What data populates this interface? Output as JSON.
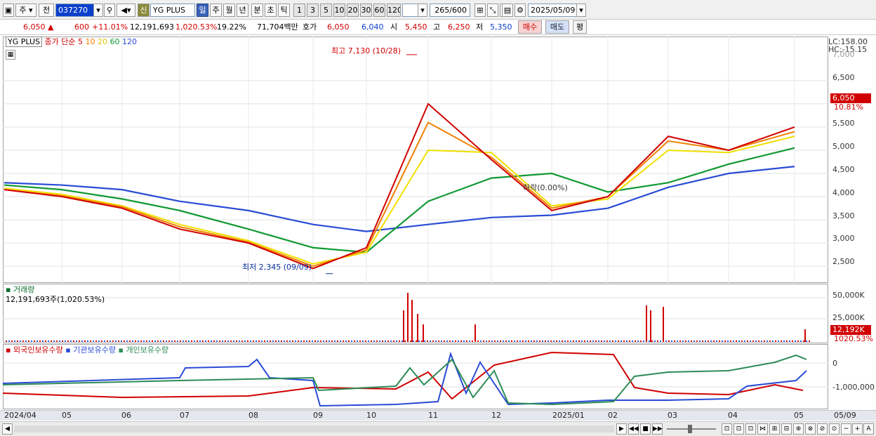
{
  "toolbar": {
    "market": "주",
    "prev": "전",
    "code": "037270",
    "tag_new": "신",
    "stock_name": "YG PLUS",
    "periods": [
      "일",
      "주",
      "월",
      "년",
      "분",
      "초",
      "틱"
    ],
    "intervals": [
      "1",
      "3",
      "5",
      "10",
      "20",
      "30",
      "60",
      "120"
    ],
    "count": "265/600",
    "date": "2025/05/09"
  },
  "quote": {
    "price": "6,050 ▲",
    "change": "600",
    "change_pct": "+11.01%",
    "volume": "12,191,693",
    "volume_pct": "1,020.53%",
    "turnover": "19.22%",
    "amount": "71,704백만",
    "hoga_label": "호가",
    "ask": "6,050",
    "bid": "6,040",
    "open_label": "시",
    "open": "5,450",
    "high_label": "고",
    "high": "6,250",
    "low_label": "저",
    "low": "5,350",
    "buy": "매수",
    "sell": "매도",
    "eval": "평"
  },
  "price_panel": {
    "name": "YG PLUS",
    "legend": {
      "close": "종가",
      "type": "단순",
      "ma5": "5",
      "ma10": "10",
      "ma20": "20",
      "ma60": "60",
      "ma120": "120"
    },
    "high_note": "최고 7,130 (10/28)",
    "low_note": "최저 2,345 (09/09)",
    "mid_note": "하락(0.00%)",
    "lc": "LC:158.00",
    "hc": "HC:-15.15",
    "price_tag": "6,050",
    "pct_tag": "10.81%",
    "ticks": [
      "7,000",
      "6,500",
      "6,000",
      "5,500",
      "5,000",
      "4,500",
      "4,000",
      "3,500",
      "3,000",
      "2,500"
    ]
  },
  "volume_panel": {
    "title": "거래량",
    "value": "12,191,693주(1,020.53%)",
    "ticks": [
      "50,000K",
      "25,000K"
    ],
    "tag": "12,192K",
    "pct": "1020.53%"
  },
  "holdings_panel": {
    "foreign": "외국인보유수량",
    "inst": "기관보유수량",
    "indiv": "개인보유수량",
    "ticks": [
      "0",
      "-1,000,000"
    ]
  },
  "dates": [
    "2024/04",
    "05",
    "06",
    "07",
    "08",
    "09",
    "10",
    "11",
    "12",
    "2025/01",
    "02",
    "03",
    "04",
    "05",
    "05/09"
  ],
  "colors": {
    "ma5": "#d10000",
    "ma10": "#f08000",
    "ma20": "#f0e000",
    "ma60": "#119933",
    "ma120": "#2a4bd6"
  },
  "chart_data": {
    "type": "line",
    "x": [
      "2024/04",
      "05",
      "06",
      "07",
      "08",
      "09",
      "10",
      "11",
      "12",
      "2025/01",
      "02",
      "03",
      "04",
      "05"
    ],
    "series": [
      {
        "name": "5",
        "values": [
          4150,
          4000,
          3750,
          3300,
          3000,
          2450,
          2900,
          6000,
          4800,
          3700,
          4000,
          5300,
          5000,
          5500
        ]
      },
      {
        "name": "10",
        "values": [
          4150,
          4020,
          3780,
          3350,
          3020,
          2500,
          2850,
          5600,
          4850,
          3750,
          4000,
          5200,
          5000,
          5400
        ]
      },
      {
        "name": "20",
        "values": [
          4180,
          4050,
          3800,
          3400,
          3050,
          2550,
          2800,
          5000,
          4950,
          3800,
          3950,
          5000,
          4950,
          5300
        ]
      },
      {
        "name": "60",
        "values": [
          4250,
          4150,
          3950,
          3700,
          3300,
          2900,
          2800,
          3900,
          4400,
          4500,
          4100,
          4300,
          4700,
          5050
        ]
      },
      {
        "name": "120",
        "values": [
          4300,
          4250,
          4150,
          3900,
          3700,
          3400,
          3250,
          3400,
          3550,
          3600,
          3750,
          4200,
          4500,
          4650
        ]
      }
    ],
    "ylim": [
      2200,
      7300
    ]
  }
}
